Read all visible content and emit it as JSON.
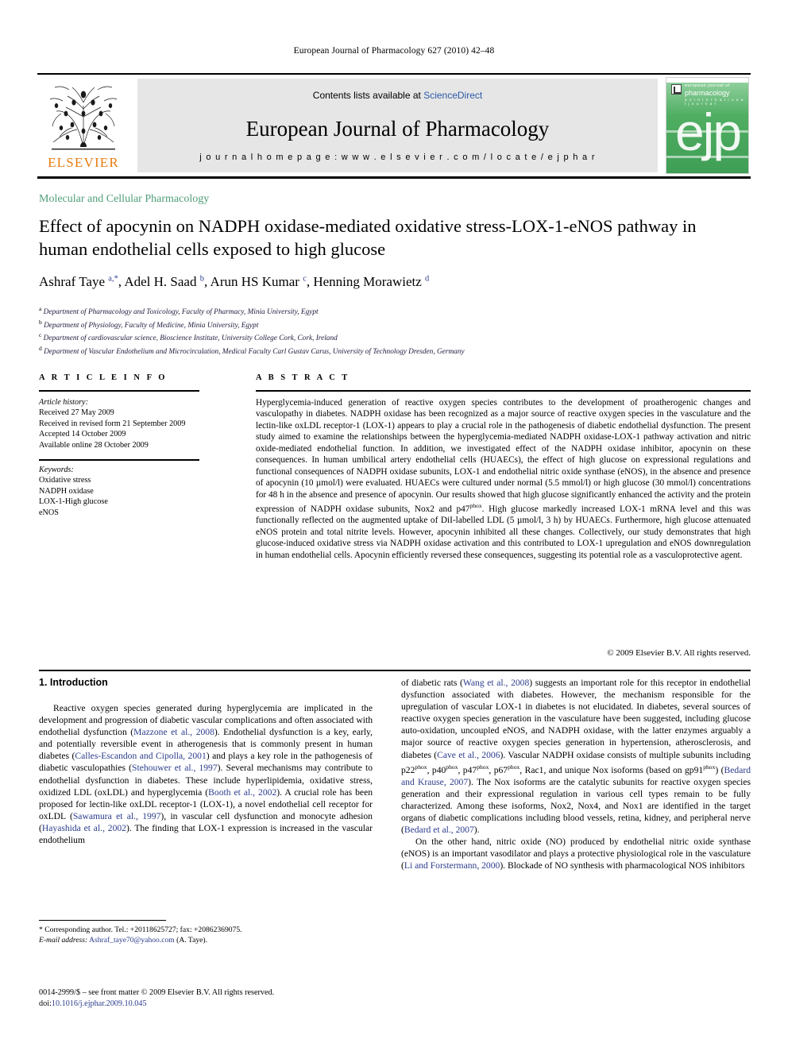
{
  "running_head": "European Journal of Pharmacology 627 (2010) 42–48",
  "masthead": {
    "contents_prefix": "Contents lists available at ",
    "sciencedirect": "ScienceDirect",
    "journal_title": "European Journal of Pharmacology",
    "homepage_label": "j o u r n a l   h o m e p a g e :   w w w . e l s e v i e r . c o m / l o c a t e / e j p h a r",
    "publisher": "ELSEVIER",
    "cover": {
      "line1": "european journal of",
      "line2": "pharmacology",
      "line3": "a n   i n t e r n a t i o n a l   j o u r n a l",
      "glyph": "ejp"
    }
  },
  "section_label": "Molecular and Cellular Pharmacology",
  "title": "Effect of apocynin on NADPH oxidase-mediated oxidative stress-LOX-1-eNOS pathway in human endothelial cells exposed to high glucose",
  "authors_html": "Ashraf Taye <sup>a,*</sup>, Adel H. Saad <sup>b</sup>, Arun HS Kumar <sup>c</sup>, Henning Morawietz <sup>d</sup>",
  "affiliations": [
    {
      "mark": "a",
      "text": "Department of Pharmacology and Toxicology, Faculty of Pharmacy, Minia University, Egypt"
    },
    {
      "mark": "b",
      "text": "Department of Physiology, Faculty of Medicine, Minia University, Egypt"
    },
    {
      "mark": "c",
      "text": "Department of cardiovascular science, Bioscience Institute, University College Cork, Cork, Ireland"
    },
    {
      "mark": "d",
      "text": "Department of Vascular Endothelium and Microcirculation, Medical Faculty Carl Gustav Carus, University of Technology Dresden, Germany"
    }
  ],
  "info_head": "A R T I C L E   I N F O",
  "abstract_head": "A B S T R A C T",
  "article_history": {
    "label": "Article history:",
    "lines": [
      "Received 27 May 2009",
      "Received in revised form 21 September 2009",
      "Accepted 14 October 2009",
      "Available online 28 October 2009"
    ]
  },
  "keywords": {
    "label": "Keywords:",
    "items": [
      "Oxidative stress",
      "NADPH oxidase",
      "LOX-1-High glucose",
      "eNOS"
    ]
  },
  "abstract_html": "Hyperglycemia-induced generation of reactive oxygen species contributes to the development of proatherogenic changes and vasculopathy in diabetes. NADPH oxidase has been recognized as a major source of reactive oxygen species in the vasculature and the lectin-like oxLDL receptor-1 (LOX-1) appears to play a crucial role in the pathogenesis of diabetic endothelial dysfunction. The present study aimed to examine the relationships between the hyperglycemia-mediated NADPH oxidase-LOX-1 pathway activation and nitric oxide-mediated endothelial function. In addition, we investigated effect of the NADPH oxidase inhibitor, apocynin on these consequences. In human umbilical artery endothelial cells (HUAECs), the effect of high glucose on expressional regulations and functional consequences of NADPH oxidase subunits, LOX-1 and endothelial nitric oxide synthase (eNOS), in the absence and presence of apocynin (10 µmol/l) were evaluated. HUAECs were cultured under normal (5.5 mmol/l) or high glucose (30 mmol/l) concentrations for 48 h in the absence and presence of apocynin. Our results showed that high glucose significantly enhanced the activity and the protein expression of NADPH oxidase subunits, Nox2 and p47<sup>phox</sup>. High glucose markedly increased LOX-1 mRNA level and this was functionally reflected on the augmented uptake of DiI-labelled LDL (5 µmol/l, 3 h) by HUAECs. Furthermore, high glucose attenuated eNOS protein and total nitrite levels. However, apocynin inhibited all these changes. Collectively, our study demonstrates that high glucose-induced oxidative stress via NADPH oxidase activation and this contributed to LOX-1 upregulation and eNOS downregulation in human endothelial cells. Apocynin efficiently reversed these consequences, suggesting its potential role as a vasculoprotective agent.",
  "copyright": "© 2009 Elsevier B.V. All rights reserved.",
  "intro_heading": "1. Introduction",
  "intro_left_html": "Reactive oxygen species generated during hyperglycemia are implicated in the development and progression of diabetic vascular complications and often associated with endothelial dysfunction (<span class=\"ref\">Mazzone et al., 2008</span>). Endothelial dysfunction is a key, early, and potentially reversible event in atherogenesis that is commonly present in human diabetes (<span class=\"ref\">Calles-Escandon and Cipolla, 2001</span>) and plays a key role in the pathogenesis of diabetic vasculopathies (<span class=\"ref\">Stehouwer et al., 1997</span>). Several mechanisms may contribute to endothelial dysfunction in diabetes. These include hyperlipidemia, oxidative stress, oxidized LDL (oxLDL) and hyperglycemia (<span class=\"ref\">Booth et al., 2002</span>). A crucial role has been proposed for lectin-like oxLDL receptor-1 (LOX-1), a novel endothelial cell receptor for oxLDL (<span class=\"ref\">Sawamura et al., 1997</span>), in vascular cell dysfunction and monocyte adhesion (<span class=\"ref\">Hayashida et al., 2002</span>). The finding that LOX-1 expression is increased in the vascular endothelium",
  "intro_right_p1_html": "of diabetic rats (<span class=\"ref\">Wang et al., 2008</span>) suggests an important role for this receptor in endothelial dysfunction associated with diabetes. However, the mechanism responsible for the upregulation of vascular LOX-1 in diabetes is not elucidated. In diabetes, several sources of reactive oxygen species generation in the vasculature have been suggested, including glucose auto-oxidation, uncoupled eNOS, and NADPH oxidase, with the latter enzymes arguably a major source of reactive oxygen species generation in hypertension, atherosclerosis, and diabetes (<span class=\"ref\">Cave et al., 2006</span>). Vascular NADPH oxidase consists of multiple subunits including p22<sup>phox</sup>, p40<sup>phox</sup>, p47<sup>phox</sup>, p67<sup>phox</sup>, Rac1, and unique Nox isoforms (based on gp91<sup>phox</sup>) (<span class=\"ref\">Bedard and Krause, 2007</span>). The Nox isoforms are the catalytic subunits for reactive oxygen species generation and their expressional regulation in various cell types remain to be fully characterized. Among these isoforms, Nox2, Nox4, and Nox1 are identified in the target organs of diabetic complications including blood vessels, retina, kidney, and peripheral nerve (<span class=\"ref\">Bedard et al., 2007</span>).",
  "intro_right_p2_html": "On the other hand, nitric oxide (NO) produced by endothelial nitric oxide synthase (eNOS) is an important vasodilator and plays a protective physiological role in the vasculature (<span class=\"ref\">Li and Forstermann, 2000</span>). Blockade of NO synthesis with pharmacological NOS inhibitors",
  "footnote_html": "* Corresponding author. Tel.: +20118625727; fax: +20862369075.<br><span class=\"ital\">E-mail address:</span> <span class=\"mail\">Ashraf_taye70@yahoo.com</span> (A. Taye).",
  "imprint_html": "0014-2999/$ – see front matter © 2009 Elsevier B.V. All rights reserved.<br>doi:<span class=\"doi\">10.1016/j.ejphar.2009.10.045</span>",
  "colors": {
    "link_blue": "#2b3c8c",
    "sciencedirect_blue": "#2a58a8",
    "section_green": "#4f9e79",
    "elsevier_orange": "#e87b10",
    "band_gray": "#e6e6e6",
    "cover_green": "#4fae62"
  }
}
